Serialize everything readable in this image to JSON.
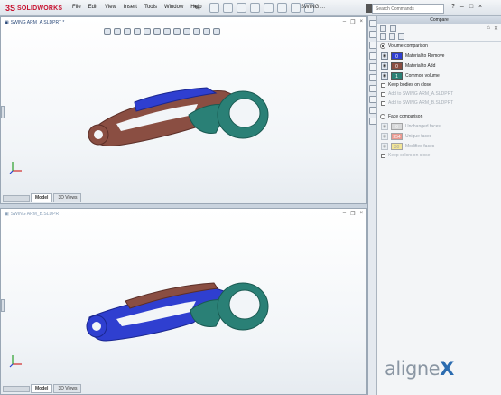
{
  "app": {
    "logo_text": "SOLIDWORKS",
    "logo_mark": "3S"
  },
  "menu": [
    "File",
    "Edit",
    "View",
    "Insert",
    "Tools",
    "Window",
    "Help"
  ],
  "document_title": "SWING ...",
  "search": {
    "placeholder": "Search Commands"
  },
  "titlebar_icons": [
    "?",
    "–",
    "□",
    "×"
  ],
  "viewport_top": {
    "title": "SWING ARM_A.SLDPRT *",
    "tabs": [
      "Model",
      "3D Views"
    ],
    "part_colors": {
      "remove": "#2f3fd0",
      "add": "#8a4e42",
      "common": "#2a8076"
    }
  },
  "viewport_bottom": {
    "title": "SWING ARM_B.SLDPRT",
    "tabs": [
      "Model",
      "3D Views"
    ]
  },
  "panel": {
    "title": "Compare",
    "volume_comparison": {
      "label": "Volume comparison",
      "rows": [
        {
          "swatch_text": "0",
          "label": "Material to Remove",
          "color": "#2f3fd0"
        },
        {
          "swatch_text": "0",
          "label": "Material to Add",
          "color": "#8a4e42"
        },
        {
          "swatch_text": "1",
          "label": "Common volume",
          "color": "#2a8076"
        }
      ],
      "keep_bodies": "Keep bodies on close",
      "add_a": "Add to SWING ARM_A.SLDPRT",
      "add_b": "Add to SWING ARM_B.SLDPRT"
    },
    "face_comparison": {
      "label": "Face comparison",
      "rows": [
        {
          "swatch_text": "0",
          "label": "Unchanged faces",
          "color": "#bfbfbf"
        },
        {
          "swatch_text": "354",
          "label": "Unique faces",
          "color": "#e2402c"
        },
        {
          "swatch_text": "30",
          "label": "Modified faces",
          "color": "#f2d63a"
        }
      ],
      "keep_colors": "Keep colors on close"
    }
  },
  "brand": {
    "name": "aligne",
    "mark": "X"
  }
}
